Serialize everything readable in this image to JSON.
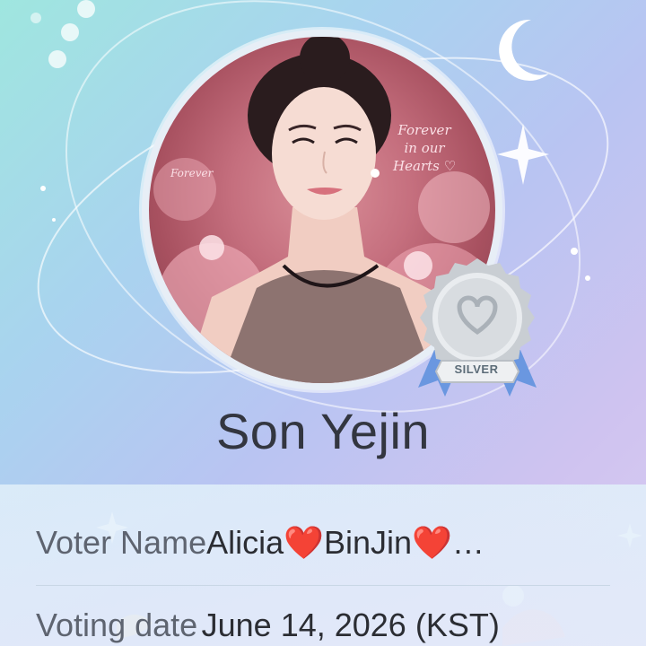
{
  "profile": {
    "name": "Son Yejin",
    "badge": "SILVER",
    "photo_caption_right": [
      "Forever",
      "in our",
      "Hearts"
    ],
    "photo_caption_left": "Forever"
  },
  "info": {
    "voter_label": "Voter Name",
    "voter_value": "Alicia❤️BinJin❤️…",
    "date_label": "Voting date",
    "date_value": "June 14, 2026 (KST)"
  },
  "colors": {
    "name_text": "#333640",
    "label_text": "#5e6470",
    "badge_silver": "#c9ced3",
    "ribbon": "#6a97e0"
  },
  "icons": [
    "moon-icon",
    "sparkle-icon",
    "heart-icon"
  ]
}
